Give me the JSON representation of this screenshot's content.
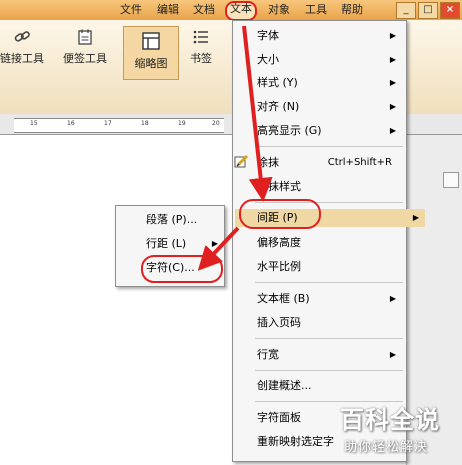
{
  "menubar": {
    "items": [
      "文件",
      "编辑",
      "文档",
      "文本",
      "对象",
      "工具",
      "帮助"
    ],
    "window_buttons": [
      "_",
      "□",
      "×"
    ]
  },
  "toolbar": {
    "link_tool": "链接工具",
    "note_tool": "便签工具",
    "thumbnail": "缩略图",
    "bookmark": "书签"
  },
  "ruler": {
    "ticks": [
      "15",
      "16",
      "17",
      "18",
      "19",
      "20"
    ]
  },
  "text_menu": {
    "font": "字体",
    "size": "大小",
    "style": "样式 (Y)",
    "align": "对齐 (N)",
    "highlight": "高亮显示 (G)",
    "erase": "涂抹",
    "erase_shortcut": "Ctrl+Shift+R",
    "erase_style": "涂抹样式",
    "spacing": "间距 (P)",
    "offset_height": "偏移高度",
    "horizontal_scale": "水平比例",
    "text_frame": "文本框 (B)",
    "insert_page_number": "插入页码",
    "line_width": "行宽",
    "create_summary": "创建概述...",
    "char_panel": "字符面板",
    "remap": "重新映射选定字"
  },
  "spacing_submenu": {
    "paragraph": "段落 (P)...",
    "line_spacing": "行距 (L)",
    "character": "字符(C)..."
  },
  "watermark": {
    "title": "百科全说",
    "subtitle": "助你轻松解决"
  },
  "colors": {
    "annotation_red": "#e02020",
    "menubar": "#eaa84e",
    "highlight": "#f0d8a4"
  }
}
